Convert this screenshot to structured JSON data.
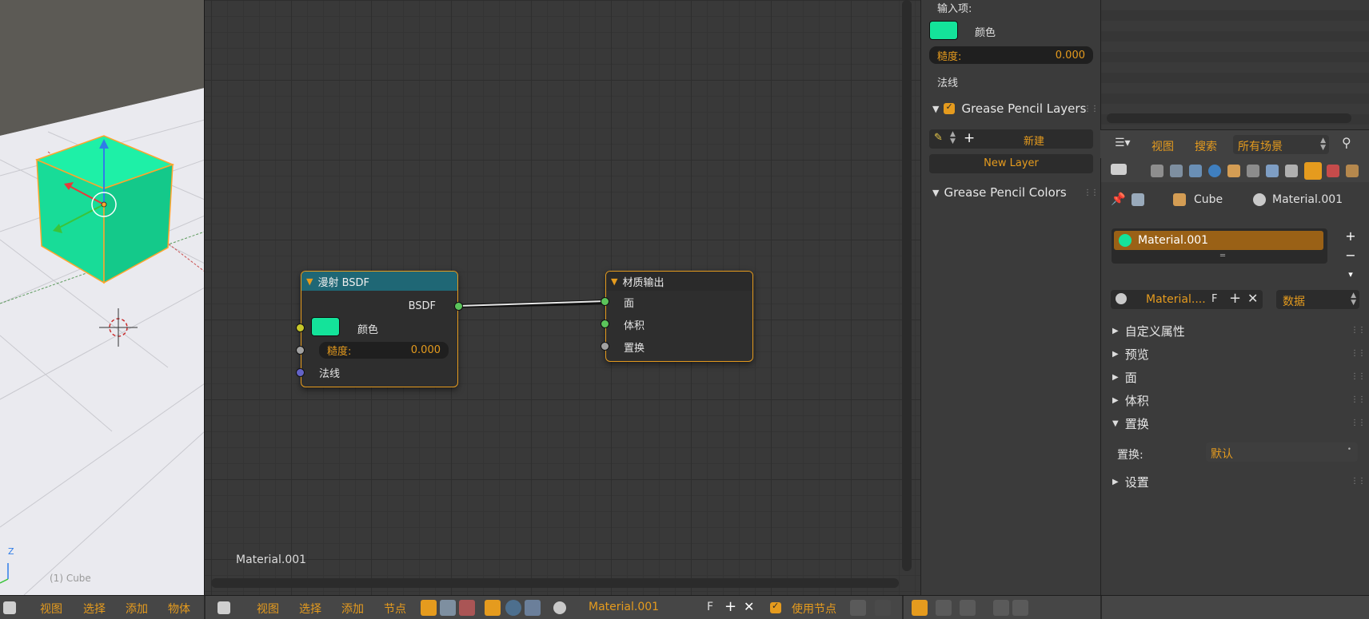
{
  "viewport": {
    "object_label": "(1) Cube",
    "axis_label": "Z",
    "header_menu": [
      "视图",
      "选择",
      "添加",
      "物体"
    ]
  },
  "node_editor": {
    "material_label": "Material.001",
    "diffuse_node": {
      "title": "漫射 BSDF",
      "output": "BSDF",
      "color_label": "颜色",
      "roughness_label": "糙度:",
      "roughness_value": "0.000",
      "normal_label": "法线"
    },
    "output_node": {
      "title": "材质输出",
      "inputs": [
        "面",
        "体积",
        "置换"
      ]
    },
    "header_menu": [
      "视图",
      "选择",
      "添加",
      "节点"
    ],
    "material_name": "Material.001",
    "fake_user": "F",
    "use_nodes_label": "使用节点"
  },
  "props_mid": {
    "inputs_heading": "输入项:",
    "color_label": "颜色",
    "roughness_label": "糙度:",
    "roughness_value": "0.000",
    "normal_label": "法线",
    "gp_layers_title": "Grease Pencil Layers",
    "new_label": "新建",
    "new_layer_label": "New Layer",
    "gp_colors_title": "Grease Pencil Colors"
  },
  "right_header": {
    "view": "视图",
    "search": "搜索",
    "scene_filter": "所有场景"
  },
  "props_right": {
    "breadcrumb_object": "Cube",
    "breadcrumb_material": "Material.001",
    "slot_name": "Material.001",
    "material_field": "Material....",
    "fake_user": "F",
    "data_dropdown": "数据",
    "sections": [
      "自定义属性",
      "预览",
      "面",
      "体积",
      "置换"
    ],
    "displacement_label": "置换:",
    "displacement_value": "默认",
    "settings_section": "设置"
  },
  "colors": {
    "accent": "#e59b1e",
    "material_swatch": "#14e39a",
    "diffuse_header": "#1f6775"
  }
}
